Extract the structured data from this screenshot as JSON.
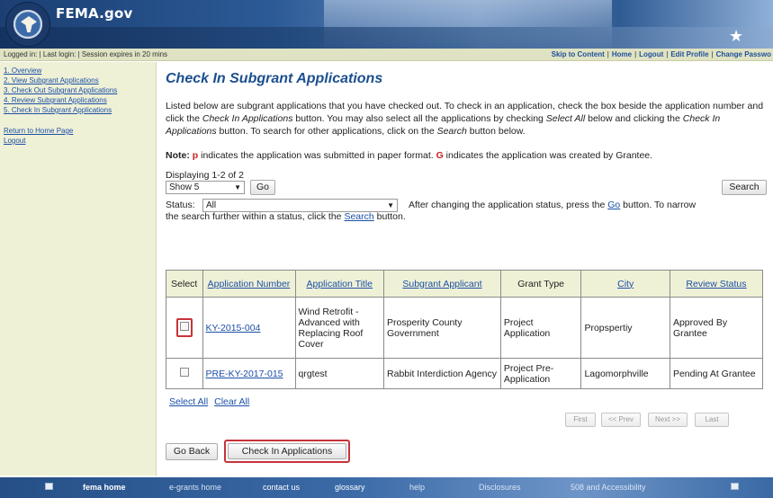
{
  "header": {
    "brand": "FEMA.gov",
    "flag_glyph": "★"
  },
  "statusbar": {
    "left_text": "Logged in:  | Last login:   | Session expires in 20 mins",
    "links": [
      "Skip to Content",
      "Home",
      "Logout",
      "Edit Profile",
      "Change Passwo"
    ]
  },
  "sidebar": {
    "items": [
      "1. Overview",
      "2. View Subgrant Applications",
      "3. Check Out Subgrant Applications",
      "4. Review Subgrant Applications",
      "5. Check In Subgrant Applications"
    ],
    "return_home": "Return to Home Page",
    "logout": "Logout"
  },
  "main": {
    "title": "Check In Subgrant Applications",
    "intro": {
      "p1": "Listed below are subgrant applications that you have checked out. To check in an application, check the box beside the application number and click the ",
      "i1": "Check In Applications",
      "p2": " button. You may also select all the applications by checking ",
      "i2": "Select All",
      "p3": " below and clicking the ",
      "i3": "Check In Applications",
      "p4": " button. To search for other applications, click on the ",
      "i4": "Search",
      "p5": " button below."
    },
    "note": {
      "label": "Note:",
      "p_marker": "p",
      "p_text": " indicates the application was submitted in paper format. ",
      "g_marker": "G",
      "g_text": " indicates the application was created by Grantee."
    },
    "displaying": "Displaying 1-2 of 2",
    "show_select": "Show 5",
    "go_label": "Go",
    "search_label": "Search",
    "status_label": "Status:",
    "status_select": "All",
    "status_hint_a": "After changing the application status, press the ",
    "status_hint_go": "Go",
    "status_hint_b": " button. To narrow",
    "hint2_a": "the search further within a status, click the ",
    "hint2_search": "Search",
    "hint2_b": " button."
  },
  "table": {
    "headers": [
      "Select",
      "Application Number",
      "Application Title",
      "Subgrant Applicant",
      "Grant Type",
      "City",
      "Review Status"
    ],
    "rows": [
      {
        "number": "KY-2015-004",
        "title": "Wind Retrofit - Advanced with Replacing Roof Cover",
        "applicant": "Prosperity County Government",
        "type": "Project Application",
        "city": "Propspertiy",
        "status": "Approved By Grantee"
      },
      {
        "number": "PRE-KY-2017-015",
        "title": "qrgtest",
        "applicant": "Rabbit Interdiction Agency",
        "type": "Project Pre-Application",
        "city": "Lagomorphville",
        "status": "Pending At Grantee"
      }
    ]
  },
  "select_all": "Select All",
  "clear_all": "Clear All",
  "pager": {
    "first": "First",
    "prev": "<< Prev",
    "next": "Next >>",
    "last": "Last"
  },
  "actions": {
    "go_back": "Go Back",
    "check_in": "Check In Applications"
  },
  "footer": {
    "items": [
      "fema home",
      "e-grants home",
      "contact us",
      "glossary",
      "help",
      "Disclosures",
      "508 and Accessibility"
    ]
  },
  "colors": {
    "accent_red": "#c8333a",
    "link_blue": "#1c4fa8",
    "sidebar_bg": "#eff1d6"
  }
}
